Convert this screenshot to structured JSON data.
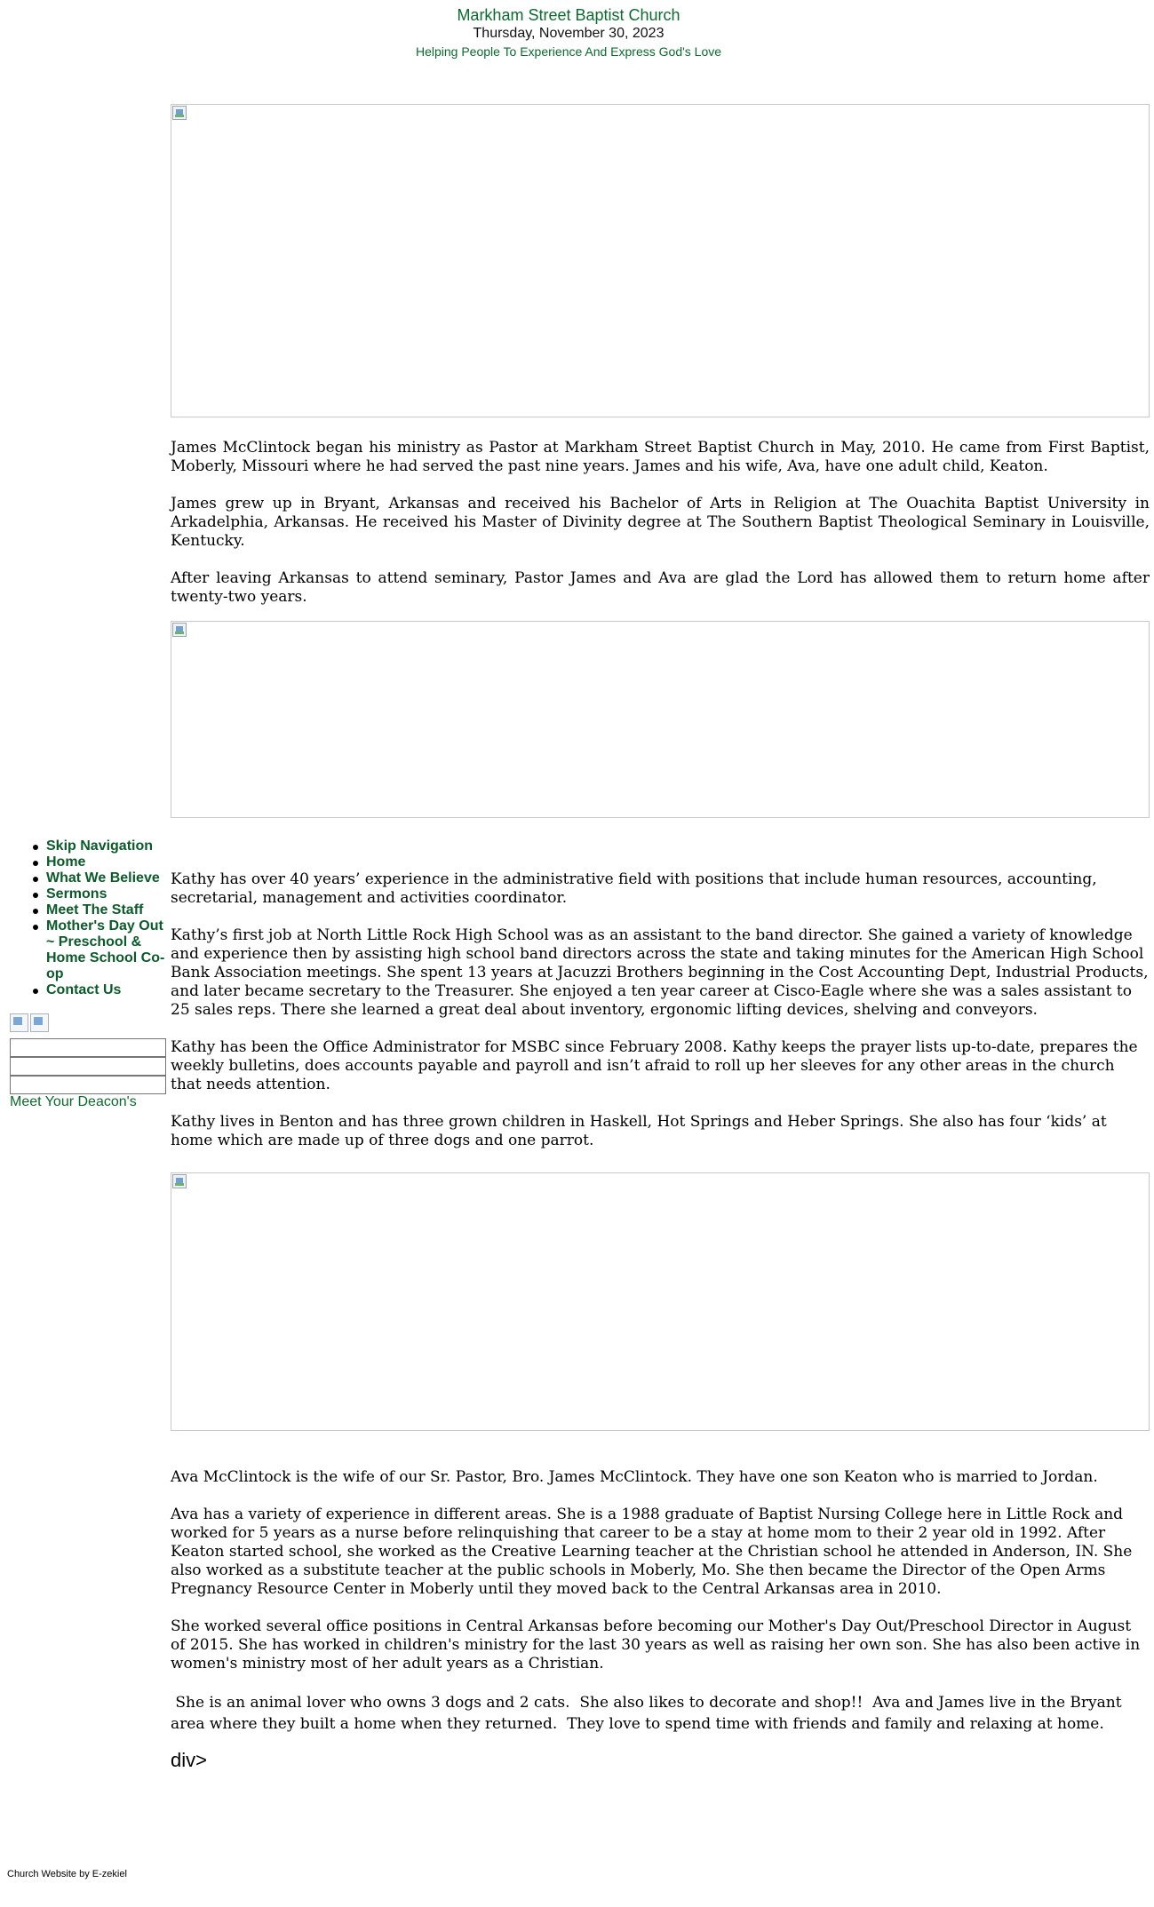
{
  "header": {
    "title": "Markham Street Baptist Church",
    "date": "Thursday, November 30, 2023",
    "tagline": "Helping People To Experience And Express God's Love"
  },
  "nav": {
    "items": [
      {
        "label": "Skip Navigation"
      },
      {
        "label": "Home"
      },
      {
        "label": "What We Believe"
      },
      {
        "label": "Sermons"
      },
      {
        "label": "Meet The Staff"
      },
      {
        "label": "Mother's Day Out ~ Preschool & Home School Co-op"
      },
      {
        "label": "Contact Us"
      }
    ],
    "deacons_link": "Meet Your Deacon's"
  },
  "sections": {
    "james": [
      "James McClintock began his ministry as Pastor at Markham Street Baptist Church in May, 2010. He came from First Baptist, Moberly, Missouri where he had served the past nine years. James and his wife, Ava, have one adult child, Keaton.",
      "James grew up in Bryant, Arkansas and received his Bachelor of Arts in Religion at The Ouachita Baptist University in Arkadelphia, Arkansas. He received his Master of Divinity degree at The Southern Baptist Theological Seminary in Louisville, Kentucky.",
      "After leaving Arkansas to attend seminary, Pastor James and Ava are glad the Lord has allowed them to return home after twenty-two years."
    ],
    "kathy": [
      "Kathy has over 40 years’ experience in the administrative field with positions that include human resources, accounting, secretarial, management and activities coordinator.",
      "Kathy’s first job at North Little Rock High School was as an assistant to the band director.  She gained a variety of knowledge and experience then by assisting high school band directors across the state and taking minutes for the American High School Bank Association meetings.  She spent 13 years at Jacuzzi Brothers beginning in the Cost Accounting Dept, Industrial Products, and later became secretary to the Treasurer.  She enjoyed a ten year career at Cisco-Eagle where she was a sales assistant to 25 sales reps. There she learned a great deal about inventory, ergonomic lifting devices, shelving and conveyors.",
      "Kathy has been the Office Administrator for MSBC since February 2008.  Kathy keeps the prayer lists up-to-date, prepares the weekly bulletins, does accounts payable and payroll and isn’t afraid to roll up her sleeves for any other areas in the church that needs attention.",
      "Kathy lives in Benton and has three grown children in Haskell, Hot Springs and Heber Springs.  She also has four ‘kids’ at home which are made up of three dogs and one parrot."
    ],
    "ava": [
      "Ava McClintock is the wife of our Sr. Pastor, Bro. James McClintock.  They have one son Keaton who is married to Jordan.",
      "Ava has a variety of experience in different areas.  She is a 1988 graduate of Baptist Nursing College here in Little Rock and worked for 5 years as a nurse before relinquishing that career to be a stay at home mom to their 2 year old in 1992.  After Keaton started school,  she worked as the Creative Learning teacher at the Christian school he attended in Anderson, IN. She also worked as a substitute teacher at the public schools in Moberly, Mo.   She then became the Director of the Open Arms Pregnancy Resource Center in Moberly until they moved back to the Central Arkansas area in 2010.",
      "She worked several office positions in Central Arkansas before becoming our Mother's Day Out/Preschool Director in August of 2015.  She has worked in children's ministry for the last 30 years as well as raising her own son.  She has also been active in women's ministry most of her adult years as a Christian.",
      " She is an animal lover who owns 3 dogs and 2 cats.  She also likes to decorate and shop!!  Ava and James live in the Bryant area where they built a home when they returned.  They love to spend time with friends and family and relaxing at home."
    ]
  },
  "stray_text": "div>",
  "footer": "Church Website by E-zekiel",
  "colors": {
    "brand_green": "#0b6b2e",
    "nav_green": "#0b5a2a",
    "image_border": "#c8c8c8"
  },
  "icons": [
    "broken-image-icon"
  ]
}
